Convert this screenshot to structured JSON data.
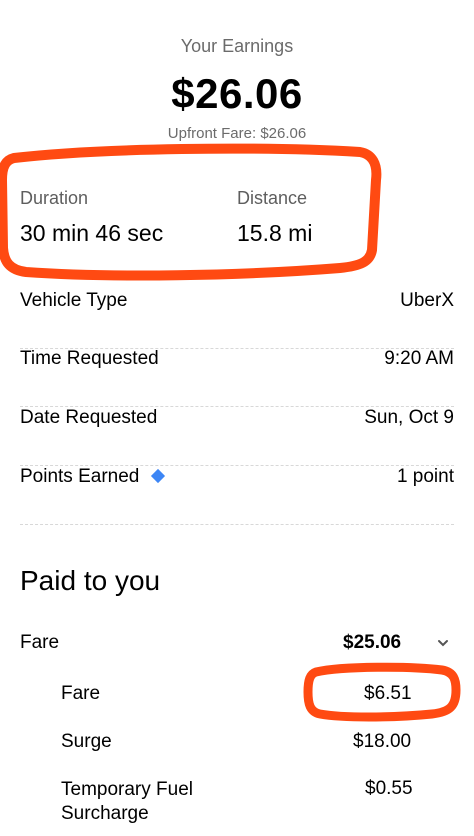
{
  "earnings": {
    "label": "Your Earnings",
    "amount": "$26.06",
    "upfront": "Upfront Fare: $26.06"
  },
  "stats": {
    "duration_label": "Duration",
    "duration_value": "30 min 46 sec",
    "distance_label": "Distance",
    "distance_value": "15.8 mi"
  },
  "details": [
    {
      "label": "Vehicle Type",
      "value": "UberX"
    },
    {
      "label": "Time Requested",
      "value": "9:20 AM"
    },
    {
      "label": "Date Requested",
      "value": "Sun, Oct 9"
    },
    {
      "label": "Points Earned",
      "value": "1 point",
      "icon": "diamond-icon"
    }
  ],
  "paid": {
    "title": "Paid to you",
    "fare_label": "Fare",
    "fare_total": "$25.06",
    "breakdown": [
      {
        "label": "Fare",
        "value": "$6.51"
      },
      {
        "label": "Surge",
        "value": "$18.00"
      },
      {
        "label": "Temporary Fuel Surcharge",
        "value": "$0.55"
      }
    ]
  },
  "colors": {
    "annotation": "#ff4a12",
    "points_icon": "#3d86f5"
  }
}
